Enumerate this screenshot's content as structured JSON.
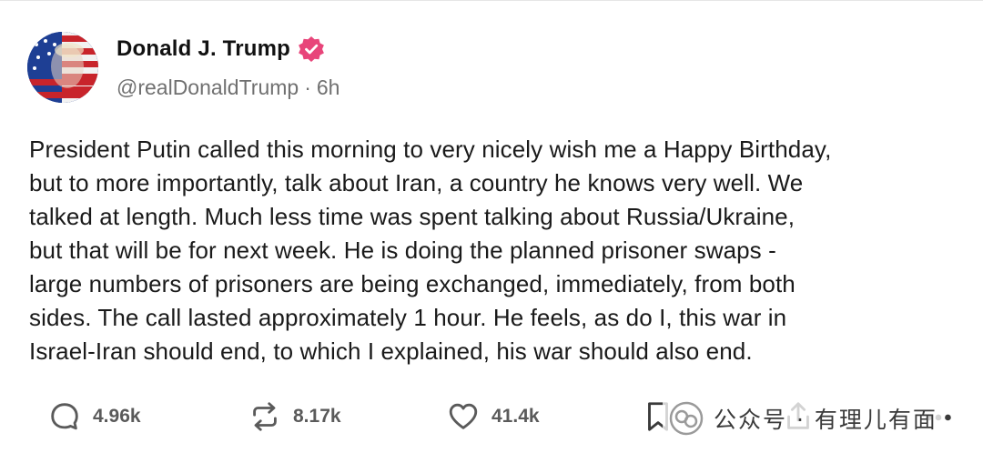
{
  "profile": {
    "display_name": "Donald J. Trump",
    "handle": "@realDonaldTrump",
    "separator": "·",
    "time_ago": "6h",
    "verified_color": "#e8457a"
  },
  "post": {
    "text": "President Putin called this morning to very nicely wish me a Happy Birthday,\nbut to more importantly, talk about Iran, a country he knows very well. We\ntalked at length. Much less time was spent talking about Russia/Ukraine,\nbut that will be for next week. He is doing the planned prisoner swaps -\nlarge numbers of prisoners are being exchanged, immediately, from both\nsides. The call lasted approximately 1 hour. He feels, as do I, this war in\nIsrael-Iran should end, to which I explained, his war should also end."
  },
  "actions": {
    "replies": "4.96k",
    "retruths": "8.17k",
    "likes": "41.4k",
    "icons": [
      "reply-icon",
      "retruth-icon",
      "like-icon",
      "bookmark-icon",
      "share-icon",
      "more-icon"
    ]
  },
  "watermark": {
    "text": "公众号 · 有理儿有面",
    "icon": "wechat-official-account-icon"
  }
}
